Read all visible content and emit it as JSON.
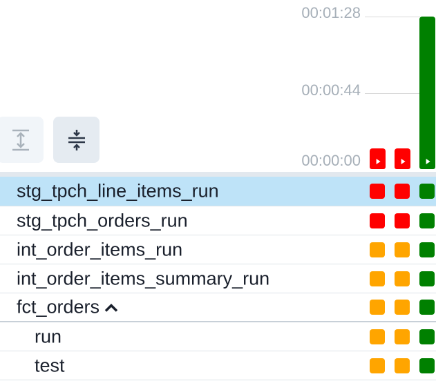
{
  "colors": {
    "failed": "#ff0000",
    "upstream_failed": "#ffa500",
    "success": "#008000",
    "selected_row": "#bee3f8"
  },
  "toolbar": {
    "expand_icon": "expand-vertical-icon",
    "collapse_icon": "collapse-vertical-icon"
  },
  "duration_axis": {
    "ticks": [
      "00:01:28",
      "00:00:44",
      "00:00:00"
    ]
  },
  "runs": [
    {
      "status": "failed",
      "icon": "play-icon",
      "duration_fraction": 0.08
    },
    {
      "status": "failed",
      "icon": "play-icon",
      "duration_fraction": 0.08
    },
    {
      "status": "success",
      "icon": "play-icon",
      "duration_fraction": 1.0
    }
  ],
  "tasks": [
    {
      "label": "stg_tpch_line_items_run",
      "selected": true,
      "statuses": [
        "failed",
        "failed",
        "success"
      ]
    },
    {
      "label": "stg_tpch_orders_run",
      "selected": false,
      "statuses": [
        "failed",
        "failed",
        "success"
      ]
    },
    {
      "label": "int_order_items_run",
      "selected": false,
      "statuses": [
        "upstream_failed",
        "upstream_failed",
        "success"
      ]
    },
    {
      "label": "int_order_items_summary_run",
      "selected": false,
      "statuses": [
        "upstream_failed",
        "upstream_failed",
        "success"
      ]
    },
    {
      "label": "fct_orders",
      "selected": false,
      "group": true,
      "expanded": true,
      "icon": "chevron-up-icon",
      "statuses": [
        "upstream_failed",
        "upstream_failed",
        "success"
      ]
    },
    {
      "label": "run",
      "selected": false,
      "child": true,
      "statuses": [
        "upstream_failed",
        "upstream_failed",
        "success"
      ]
    },
    {
      "label": "test",
      "selected": false,
      "child": true,
      "statuses": [
        "upstream_failed",
        "upstream_failed",
        "success"
      ]
    }
  ]
}
